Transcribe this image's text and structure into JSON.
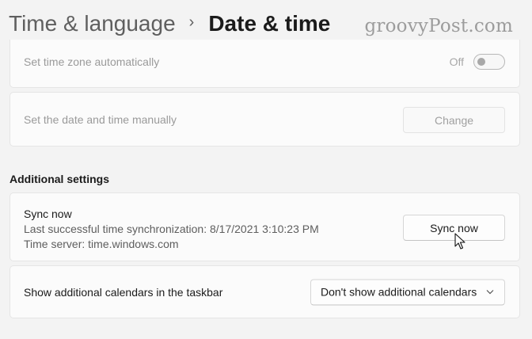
{
  "breadcrumb": {
    "parent": "Time & language",
    "separator": "›",
    "current": "Date & time"
  },
  "watermark": "groovyPost.com",
  "settings": {
    "time_zone_auto": {
      "label": "Set time zone automatically",
      "state_text": "Off",
      "on": false
    },
    "manual_datetime": {
      "label": "Set the date and time manually",
      "button": "Change"
    }
  },
  "additional": {
    "heading": "Additional settings",
    "sync": {
      "title": "Sync now",
      "last_sync": "Last successful time synchronization: 8/17/2021 3:10:23 PM",
      "server": "Time server: time.windows.com",
      "button": "Sync now"
    },
    "calendars": {
      "label": "Show additional calendars in the taskbar",
      "selected": "Don't show additional calendars"
    }
  },
  "icons": {
    "dropdown": "chevron-down-icon",
    "cursor": "mouse-pointer-icon"
  }
}
